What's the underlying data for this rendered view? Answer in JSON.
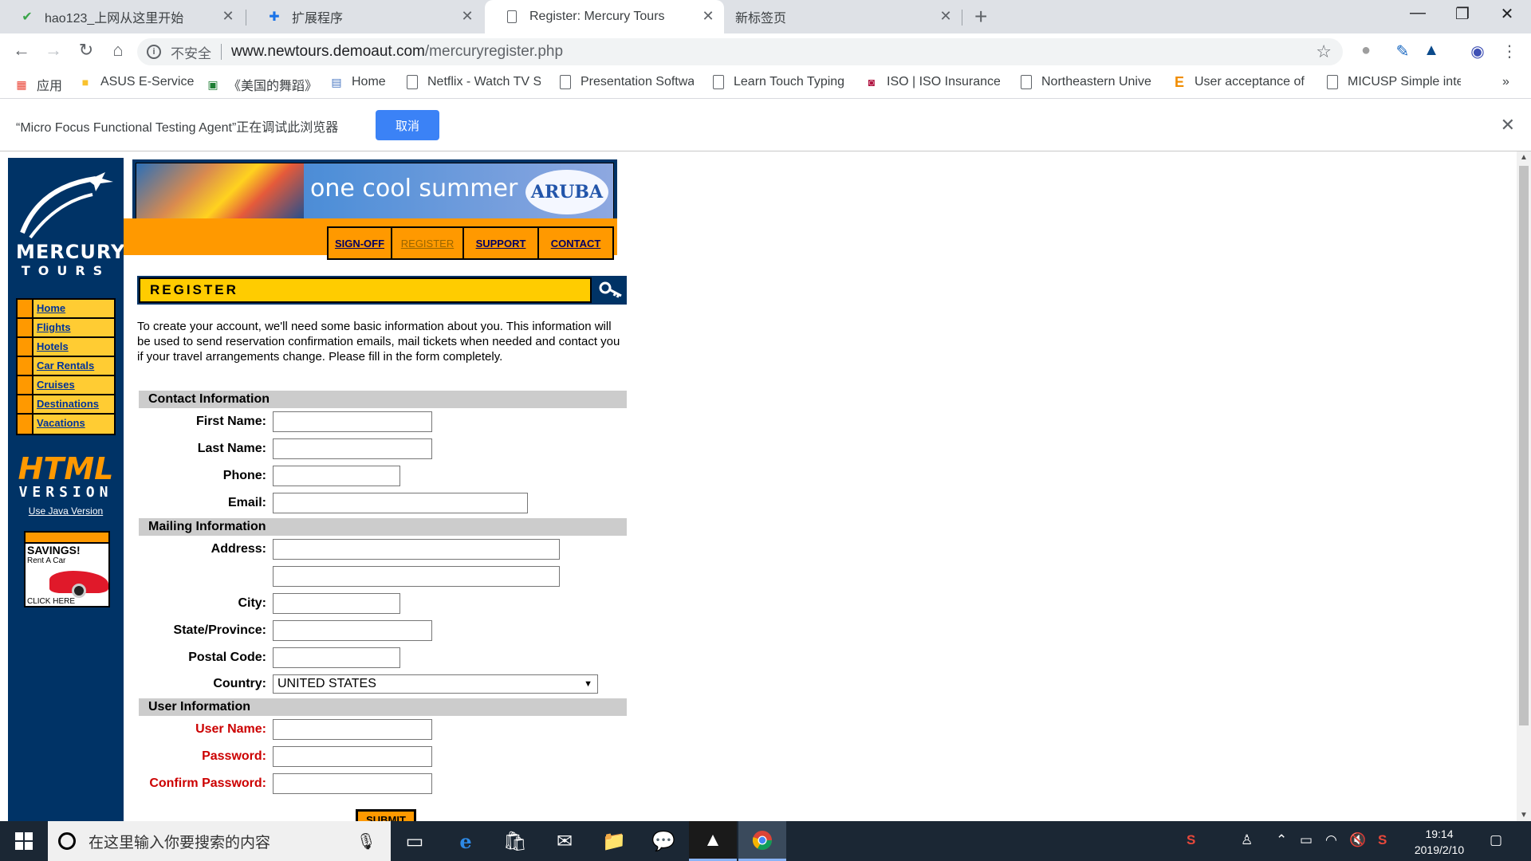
{
  "browser": {
    "tabs": [
      {
        "title": "hao123_上网从这里开始",
        "icon": "hao123-icon"
      },
      {
        "title": "扩展程序",
        "icon": "puzzle-icon"
      },
      {
        "title": "Register: Mercury Tours",
        "icon": "page-icon",
        "active": true
      },
      {
        "title": "新标签页",
        "icon": "none"
      }
    ],
    "url": {
      "security": "不安全",
      "host": "www.newtours.demoaut.com",
      "path": "/mercuryregister.php"
    },
    "bookmarks": [
      {
        "label": "应用",
        "icon": "apps-grid-icon"
      },
      {
        "label": "ASUS E-Service",
        "icon": "folder-icon"
      },
      {
        "label": "《美国的舞蹈》",
        "icon": "green-box-icon"
      },
      {
        "label": "Home",
        "icon": "doc-icon"
      },
      {
        "label": "Netflix - Watch TV S",
        "icon": "page-icon"
      },
      {
        "label": "Presentation Softwa",
        "icon": "page-icon"
      },
      {
        "label": "Learn Touch Typing",
        "icon": "page-icon"
      },
      {
        "label": "ISO | ISO Insurance",
        "icon": "iso-icon"
      },
      {
        "label": "Northeastern Unive",
        "icon": "page-icon"
      },
      {
        "label": "User acceptance of",
        "icon": "e-icon"
      },
      {
        "label": "MICUSP Simple inte",
        "icon": "page-icon"
      }
    ],
    "more_bookmarks": "»",
    "infobar": {
      "message": "“Micro Focus Functional Testing Agent”正在调试此浏览器",
      "cancel": "取消"
    }
  },
  "site": {
    "brand": "MERCURY",
    "brand_sub": "TOURS",
    "left_nav": [
      "Home",
      "Flights",
      "Hotels",
      "Car Rentals",
      "Cruises",
      "Destinations",
      "Vacations"
    ],
    "html_version": {
      "big": "HTML",
      "sub": "VERSION",
      "link": "Use Java Version"
    },
    "savings_ad": {
      "line1": "SAVINGS!",
      "line2": "Rent A Car",
      "line3": "CLICK HERE"
    },
    "banner": {
      "slogan": "one cool summer",
      "logo": "ARUBA"
    },
    "top_nav": [
      "SIGN-OFF",
      "REGISTER",
      "SUPPORT",
      "CONTACT"
    ],
    "page_heading": "REGISTER",
    "intro": "To create your account, we'll need some basic information about you. This information will be used to send reservation confirmation emails, mail tickets when needed and contact you if your travel arrangements change. Please fill in the form completely.",
    "sections": {
      "contact": "Contact Information",
      "mailing": "Mailing Information",
      "user": "User Information"
    },
    "fields": {
      "first_name": "First Name:",
      "last_name": "Last Name:",
      "phone": "Phone:",
      "email": "Email:",
      "address": "Address:",
      "city": "City:",
      "state": "State/Province:",
      "postal": "Postal Code:",
      "country": "Country:",
      "country_value": "UNITED STATES",
      "username": "User Name:",
      "password": "Password:",
      "confirm": "Confirm Password:"
    },
    "submit": "SUBMIT"
  },
  "taskbar": {
    "search_placeholder": "在这里输入你要搜索的内容",
    "time": "19:14",
    "date": "2019/2/10"
  },
  "colors": {
    "sidebar": "#003366",
    "orange": "#ff9900",
    "yellow": "#ffcc00",
    "required_label": "#cc0000"
  }
}
